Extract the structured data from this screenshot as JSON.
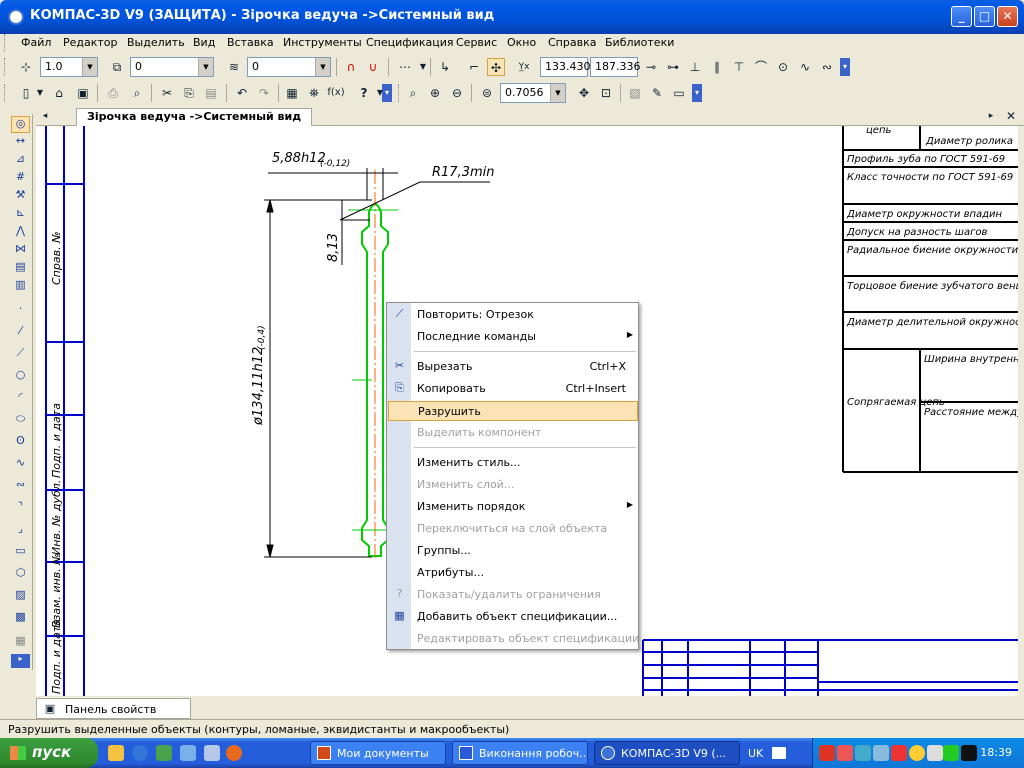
{
  "window": {
    "title": "КОМПАС-3D V9 (ЗАЩИТА) - Зірочка ведуча ->Системный вид",
    "minimize": "_",
    "maximize": "□",
    "close": "✕"
  },
  "menubar": {
    "items": [
      "Файл",
      "Редактор",
      "Выделить",
      "Вид",
      "Вставка",
      "Инструменты",
      "Спецификация",
      "Сервис",
      "Окно",
      "Справка",
      "Библиотеки"
    ]
  },
  "toolbar1": {
    "line_scale": "1.0",
    "layer": "0",
    "style": "0",
    "coord_x": "133.430",
    "coord_y": "187.336"
  },
  "toolbar2": {
    "zoom": "0.7056"
  },
  "document_tab": "Зірочка ведуча ->Системный вид",
  "drawing": {
    "dim_top": "5,88h12",
    "dim_top_tol": "(-0,12)",
    "dim_radius": "R17,3min",
    "dim_height": "8,13",
    "dim_diameter": "ø134,11h12",
    "dim_diameter_tol": "(-0,4)",
    "frame_labels": [
      "Справ. №",
      "Подп. и дата",
      "Инв. № дубл.",
      "Взам. инв. №",
      "Подп. и дата"
    ]
  },
  "spec_table": {
    "rows": [
      {
        "left": "цепь",
        "right": "Диаметр ролика"
      },
      {
        "full": "Профиль зуба по ГОСТ 591-69"
      },
      {
        "full": "Класс точности по ГОСТ 591-69"
      },
      {
        "full": "Диаметр окружности впадин"
      },
      {
        "full": "Допуск на разность шагов"
      },
      {
        "full": "Радиальное биение окружности впадин"
      },
      {
        "full": "Торцовое биение зубчатого венца"
      },
      {
        "full": "Диаметр делительной окружности"
      },
      {
        "left": "Сопрягаемая цепь",
        "right1": "Ширина внутренней пластины",
        "right2": "Расстояние между внутренними пластинами"
      }
    ]
  },
  "context_menu": {
    "items": [
      {
        "label": "Повторить: Отрезок",
        "icon": "segment-icon"
      },
      {
        "label": "Последние команды",
        "submenu": true
      },
      {
        "label": "Вырезать",
        "shortcut": "Ctrl+X",
        "icon": "scissors-icon"
      },
      {
        "label": "Копировать",
        "shortcut": "Ctrl+Insert",
        "icon": "copy-icon"
      },
      {
        "label": "Разрушить",
        "highlighted": true
      },
      {
        "label": "Выделить компонент",
        "disabled": true
      },
      {
        "label": "Изменить стиль..."
      },
      {
        "label": "Изменить слой...",
        "disabled": true
      },
      {
        "label": "Изменить порядок",
        "submenu": true
      },
      {
        "label": "Переключиться на слой объекта",
        "disabled": true
      },
      {
        "label": "Группы..."
      },
      {
        "label": "Атрибуты..."
      },
      {
        "label": "Показать/удалить ограничения",
        "disabled": true,
        "icon": "question-icon"
      },
      {
        "label": "Добавить объект спецификации...",
        "icon": "spec-add-icon"
      },
      {
        "label": "Редактировать объект спецификации",
        "disabled": true
      }
    ]
  },
  "properties_panel": "Панель свойств",
  "status": "Разрушить выделенные объекты (контуры, ломаные, эквидистанты и макрообъекты)",
  "taskbar": {
    "start": "пуск",
    "tasks": [
      "Мои документы",
      "Виконання робоч...",
      "КОМПАС-3D V9 (..."
    ],
    "lang": "UK",
    "clock": "18:39"
  },
  "colors": {
    "highlight": "#fbe3b6",
    "contour": "#00cc00",
    "frame": "#0000cc",
    "axis": "#ff6600"
  }
}
